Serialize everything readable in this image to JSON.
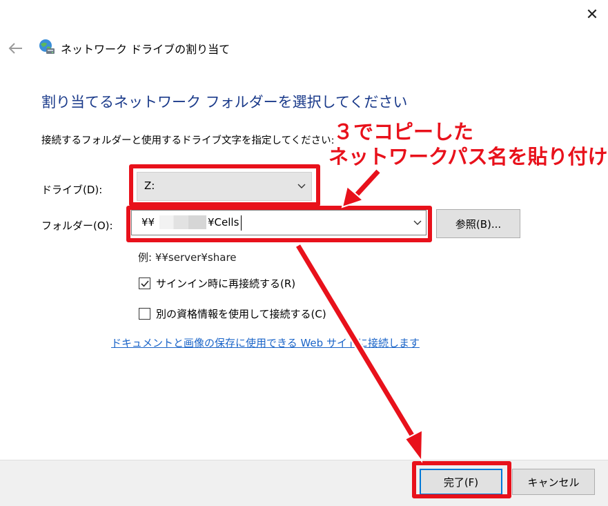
{
  "window": {
    "close_glyph": "✕",
    "title": "ネットワーク ドライブの割り当て"
  },
  "dialog": {
    "heading": "割り当てるネットワーク フォルダーを選択してください",
    "instruction": "接続するフォルダーと使用するドライブ文字を指定してください:",
    "drive_label": "ドライブ(D):",
    "drive_value": "Z:",
    "folder_label": "フォルダー(O):",
    "folder_value_prefix": "¥¥",
    "folder_value_suffix": "¥Cells",
    "browse_label": "参照(B)...",
    "example": "例: ¥¥server¥share",
    "reconnect_label": "サインイン時に再接続する(R)",
    "reconnect_checked": true,
    "credentials_label": "別の資格情報を使用して接続する(C)",
    "credentials_checked": false,
    "webdoc_link": "ドキュメントと画像の保存に使用できる Web サイトに接続します"
  },
  "footer": {
    "finish_label": "完了(F)",
    "cancel_label": "キャンセル"
  },
  "annotation": {
    "callout_line1": "３でコピーした",
    "callout_line2": "ネットワークパス名を貼り付け",
    "color": "#e8111b"
  },
  "icons": {
    "back": "back-arrow-icon",
    "app": "network-drive-icon",
    "chevron": "chevron-down-icon",
    "check": "checkmark-icon"
  }
}
